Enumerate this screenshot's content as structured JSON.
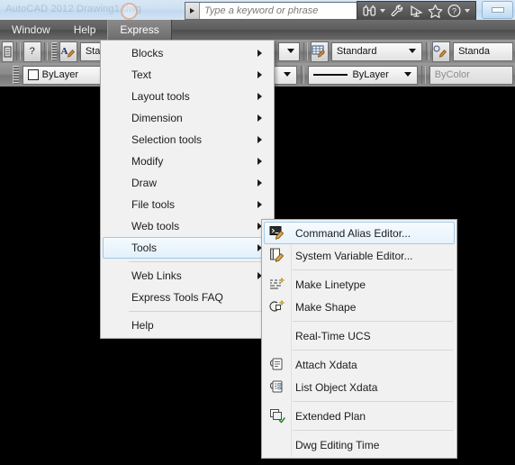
{
  "titlebar": {
    "app_title_faint": "AutoCAD  2012   Drawing1.dwg",
    "logo_icon": "autocad-logo-icon",
    "search": {
      "placeholder": "Type a keyword or phrase",
      "dropdown_icon": "triangle-right-icon"
    },
    "tools": [
      {
        "name": "search-binoculars-icon",
        "caret": true
      },
      {
        "name": "wrench-icon",
        "caret": false
      },
      {
        "name": "satellite-dish-icon",
        "caret": false
      },
      {
        "name": "favorites-star-icon",
        "caret": false
      },
      {
        "name": "help-question-icon",
        "caret": true
      }
    ],
    "window_controls": [
      {
        "name": "minimize-button",
        "glyph": "minimize"
      }
    ]
  },
  "menubar": {
    "items": [
      {
        "label": "Window",
        "active": false
      },
      {
        "label": "Help",
        "active": false
      },
      {
        "label": "Express",
        "active": true
      }
    ]
  },
  "toolbars": {
    "row1": {
      "button_text_small": "",
      "help_button_label": "?",
      "text_style_icon": "text-style-icon",
      "style_combo_value": "Sta",
      "table_style_icon": "table-style-icon",
      "table_style_value": "Standard",
      "mleader_style_icon": "multileader-style-icon",
      "mleader_style_value": "Standa"
    },
    "row2": {
      "layer_color_value": "ByLayer",
      "linetype_value": "ByLayer",
      "lineweight_value": "ByColor"
    }
  },
  "express_menu": {
    "items": [
      {
        "label": "Blocks",
        "submenu": true,
        "separator_after": false
      },
      {
        "label": "Text",
        "submenu": true,
        "separator_after": false
      },
      {
        "label": "Layout tools",
        "submenu": true,
        "separator_after": false
      },
      {
        "label": "Dimension",
        "submenu": true,
        "separator_after": false
      },
      {
        "label": "Selection tools",
        "submenu": true,
        "separator_after": false
      },
      {
        "label": "Modify",
        "submenu": true,
        "separator_after": false
      },
      {
        "label": "Draw",
        "submenu": true,
        "separator_after": false
      },
      {
        "label": "File tools",
        "submenu": true,
        "separator_after": false
      },
      {
        "label": "Web tools",
        "submenu": true,
        "separator_after": false
      },
      {
        "label": "Tools",
        "submenu": true,
        "separator_after": true,
        "highlighted": true
      },
      {
        "label": "Web Links",
        "submenu": true,
        "separator_after": false
      },
      {
        "label": "Express Tools FAQ",
        "submenu": false,
        "separator_after": true
      },
      {
        "label": "Help",
        "submenu": false,
        "separator_after": false
      }
    ]
  },
  "tools_submenu": {
    "items": [
      {
        "label": "Command Alias Editor...",
        "icon": "command-alias-editor-icon",
        "highlighted": true,
        "separator_after": false
      },
      {
        "label": "System Variable Editor...",
        "icon": "system-variable-editor-icon",
        "highlighted": false,
        "separator_after": true
      },
      {
        "label": "Make Linetype",
        "icon": "make-linetype-icon",
        "highlighted": false,
        "separator_after": false
      },
      {
        "label": "Make Shape",
        "icon": "make-shape-icon",
        "highlighted": false,
        "separator_after": true
      },
      {
        "label": "Real-Time UCS",
        "icon": "",
        "highlighted": false,
        "separator_after": true
      },
      {
        "label": "Attach Xdata",
        "icon": "attach-xdata-icon",
        "highlighted": false,
        "separator_after": false
      },
      {
        "label": "List Object Xdata",
        "icon": "list-object-xdata-icon",
        "highlighted": false,
        "separator_after": true
      },
      {
        "label": "Extended Plan",
        "icon": "extended-plan-icon",
        "highlighted": false,
        "separator_after": true
      },
      {
        "label": "Dwg Editing Time",
        "icon": "",
        "highlighted": false,
        "separator_after": false
      }
    ]
  },
  "canvas": {
    "background_color": "#000000"
  },
  "colors": {
    "menu_bg": "#f1f1f1",
    "menubar_bg": "#5d5d5d",
    "toolbar_bg": "#8a8a8a",
    "highlight_border": "#9fc8e8",
    "titlebar_blue": "#cfe1f2"
  }
}
